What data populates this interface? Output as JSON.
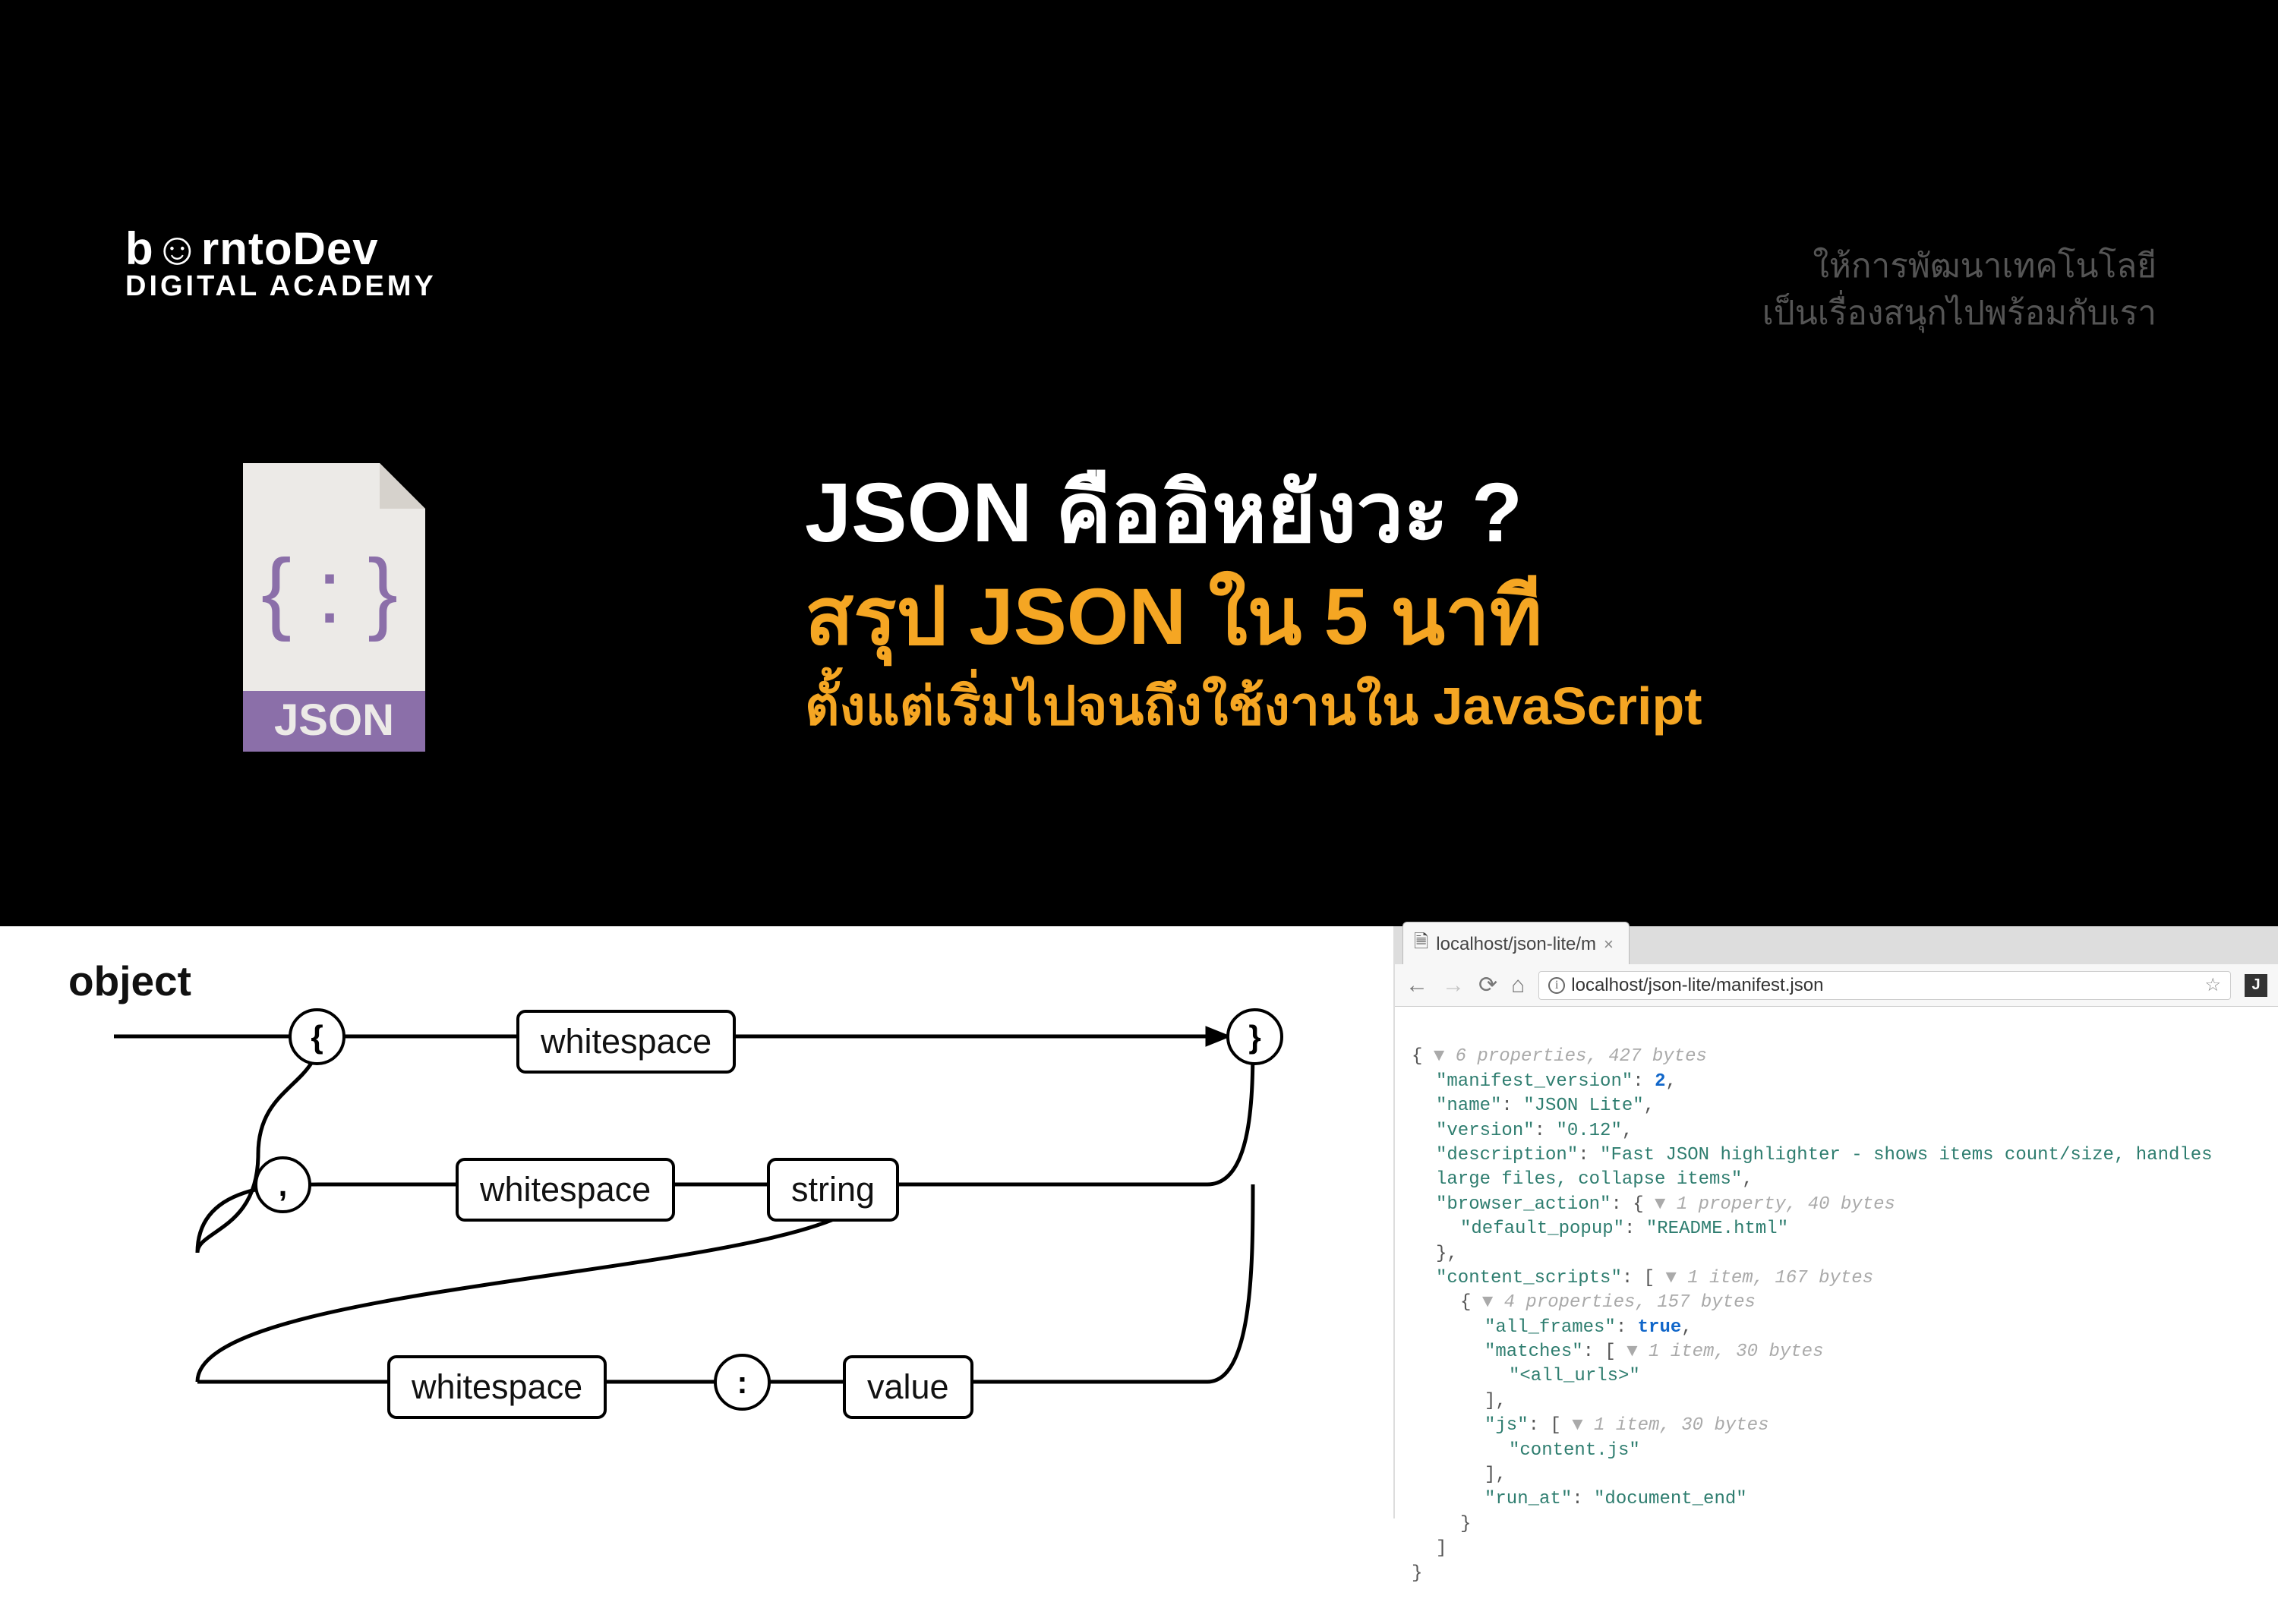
{
  "brand": {
    "name": "b☺rntoDev",
    "sub": "DIGITAL ACADEMY"
  },
  "tagline": {
    "line1": "ให้การพัฒนาเทคโนโลยี",
    "line2": "เป็นเรื่องสนุกไปพร้อมกับเรา"
  },
  "fileicon": {
    "glyph": "{ : }",
    "label": "JSON"
  },
  "title": {
    "line1": "JSON คืออิหยังวะ ?",
    "line2": "สรุป JSON ใน 5 นาที",
    "line3": "ตั้งแต่เริ่มไปจนถึงใช้งานใน JavaScript"
  },
  "railroad": {
    "title": "object",
    "open": "{",
    "close": "}",
    "comma": ",",
    "colon": ":",
    "ws1": "whitespace",
    "ws2": "whitespace",
    "ws3": "whitespace",
    "string": "string",
    "value": "value"
  },
  "browser": {
    "tab_title": "localhost/json-lite/m",
    "url": "localhost/json-lite/manifest.json",
    "star": "☆",
    "ext": "J"
  },
  "json_preview": {
    "root_meta": "6 properties, 427 bytes",
    "lines": {
      "mv_key": "\"manifest_version\"",
      "mv_val": "2",
      "name_key": "\"name\"",
      "name_val": "\"JSON Lite\"",
      "ver_key": "\"version\"",
      "ver_val": "\"0.12\"",
      "desc_key": "\"description\"",
      "desc_val": "\"Fast JSON highlighter - shows items count/size, handles",
      "desc_val2": "large files, collapse items\"",
      "ba_key": "\"browser_action\"",
      "ba_meta": "1 property, 40 bytes",
      "dp_key": "\"default_popup\"",
      "dp_val": "\"README.html\"",
      "cs_key": "\"content_scripts\"",
      "cs_meta": "1 item, 167 bytes",
      "csobj_meta": "4 properties, 157 bytes",
      "af_key": "\"all_frames\"",
      "af_val": "true",
      "m_key": "\"matches\"",
      "m_meta": "1 item, 30 bytes",
      "m_val": "\"<all_urls>\"",
      "js_key": "\"js\"",
      "js_meta": "1 item, 30 bytes",
      "js_val": "\"content.js\"",
      "ra_key": "\"run_at\"",
      "ra_val": "\"document_end\""
    }
  }
}
